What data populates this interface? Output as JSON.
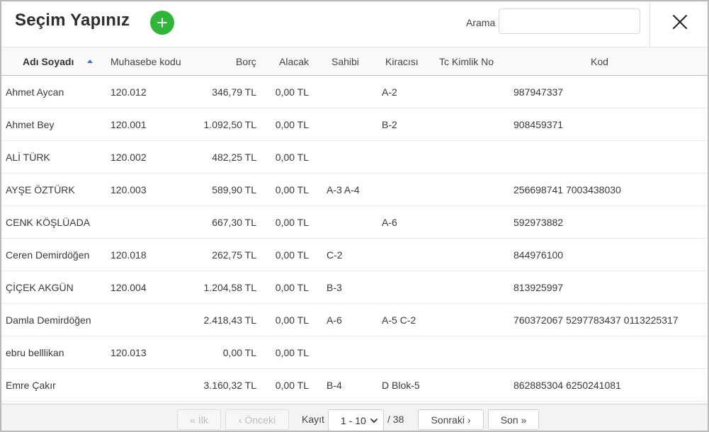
{
  "dialog": {
    "title": "Seçim Yapınız",
    "add_icon": "plus-icon",
    "search_label": "Arama",
    "search_value": "",
    "search_placeholder": "",
    "close_icon": "close-icon",
    "accent_color": "#2fb63a"
  },
  "table": {
    "columns": [
      "Adı Soyadı",
      "Muhasebe kodu",
      "Borç",
      "Alacak",
      "Sahibi",
      "Kiracısı",
      "Tc Kimlik No",
      "Kod"
    ],
    "sorted_column": "Adı Soyadı",
    "sort_direction": "ascending",
    "sort_icon": "sort-ascending-icon",
    "rows": [
      {
        "name": "Ahmet Aycan",
        "code": "120.012",
        "borc": "346,79 TL",
        "alacak": "0,00 TL",
        "sahibi": "",
        "kiracisi": "A-2",
        "tc": "",
        "kod": "987947337"
      },
      {
        "name": "Ahmet Bey",
        "code": "120.001",
        "borc": "1.092,50 TL",
        "alacak": "0,00 TL",
        "sahibi": "",
        "kiracisi": "B-2",
        "tc": "",
        "kod": "908459371"
      },
      {
        "name": "ALİ TÜRK",
        "code": "120.002",
        "borc": "482,25 TL",
        "alacak": "0,00 TL",
        "sahibi": "",
        "kiracisi": "",
        "tc": "",
        "kod": ""
      },
      {
        "name": "AYŞE ÖZTÜRK",
        "code": "120.003",
        "borc": "589,90 TL",
        "alacak": "0,00 TL",
        "sahibi": "A-3 A-4",
        "kiracisi": "",
        "tc": "",
        "kod": "256698741 7003438030"
      },
      {
        "name": "CENK KÖŞLÜADA",
        "code": "",
        "borc": "667,30 TL",
        "alacak": "0,00 TL",
        "sahibi": "",
        "kiracisi": "A-6",
        "tc": "",
        "kod": "592973882"
      },
      {
        "name": "Ceren Demirdöğen",
        "code": "120.018",
        "borc": "262,75 TL",
        "alacak": "0,00 TL",
        "sahibi": "C-2",
        "kiracisi": "",
        "tc": "",
        "kod": "844976100"
      },
      {
        "name": "ÇİÇEK AKGÜN",
        "code": "120.004",
        "borc": "1.204,58 TL",
        "alacak": "0,00 TL",
        "sahibi": "B-3",
        "kiracisi": "",
        "tc": "",
        "kod": "813925997"
      },
      {
        "name": "Damla Demirdöğen",
        "code": "",
        "borc": "2.418,43 TL",
        "alacak": "0,00 TL",
        "sahibi": "A-6",
        "kiracisi": "A-5 C-2",
        "tc": "",
        "kod": "760372067 5297783437 0113225317"
      },
      {
        "name": "ebru belllikan",
        "code": "120.013",
        "borc": "0,00 TL",
        "alacak": "0,00 TL",
        "sahibi": "",
        "kiracisi": "",
        "tc": "",
        "kod": ""
      },
      {
        "name": "Emre Çakır",
        "code": "",
        "borc": "3.160,32 TL",
        "alacak": "0,00 TL",
        "sahibi": "B-4",
        "kiracisi": "D Blok-5",
        "tc": "",
        "kod": "862885304 6250241081"
      }
    ]
  },
  "pagination": {
    "first_label": "« İlk",
    "prev_label": "‹ Önceki",
    "record_label": "Kayıt",
    "range_value": "1 - 10",
    "range_icon": "chevron-down-icon",
    "total_label": "/ 38",
    "next_label": "Sonraki ›",
    "last_label": "Son »"
  }
}
